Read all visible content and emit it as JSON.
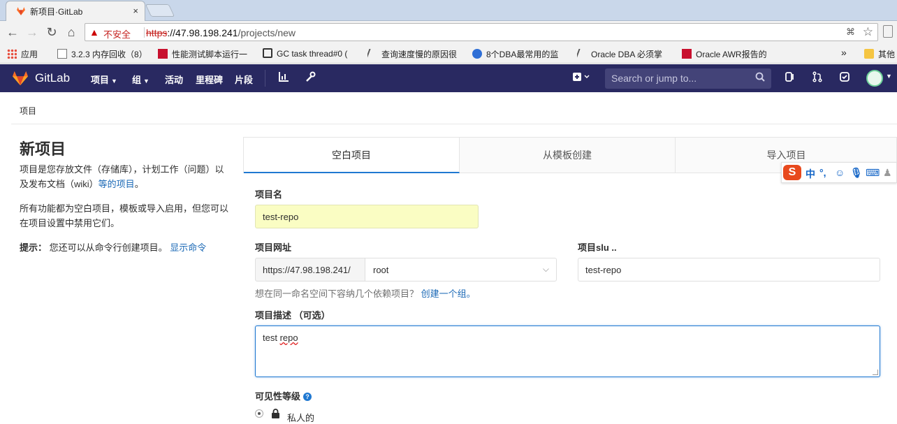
{
  "browser": {
    "tab_title": "新项目·GitLab",
    "tab_close": "×",
    "insecure_label": "不安全",
    "url_scheme": "https",
    "url_host": "://47.98.198.241",
    "url_path": "/projects/new",
    "bookmarks": [
      {
        "label": "应用",
        "icon": "apps-icon",
        "color": "#e74c3c"
      },
      {
        "label": "3.2.3 内存回收（8）",
        "icon": "page-icon",
        "color": "#777777"
      },
      {
        "label": "性能测试脚本运行一",
        "icon": "c-icon",
        "color": "#c8102e"
      },
      {
        "label": "GC task thread#0 (",
        "icon": "g-icon",
        "color": "#333333"
      },
      {
        "label": "查询速度慢的原因很",
        "icon": "sword-icon",
        "color": "#555555"
      },
      {
        "label": "8个DBA最常用的监",
        "icon": "paw-icon",
        "color": "#2f6fd6"
      },
      {
        "label": "Oracle DBA 必须掌",
        "icon": "sword-icon",
        "color": "#555555"
      },
      {
        "label": "Oracle AWR报告的",
        "icon": "c-icon",
        "color": "#c8102e"
      }
    ],
    "bookmarks_more": "»",
    "other_bookmarks": "其他"
  },
  "gitlab": {
    "brand": "GitLab",
    "nav": [
      {
        "label": "项目",
        "caret": true
      },
      {
        "label": "组",
        "caret": true
      },
      {
        "label": "活动",
        "caret": false
      },
      {
        "label": "里程碑",
        "caret": false
      },
      {
        "label": "片段",
        "caret": false
      }
    ],
    "search_placeholder": "Search or jump to...",
    "colors": {
      "header": "#292961",
      "accent": "#1f78d1",
      "logo": "#fc6d26"
    }
  },
  "page": {
    "breadcrumb": "项目",
    "title": "新项目",
    "intro_text": "项目是您存放文件（存储库），计划工作（问题）以及发布文档（wiki）",
    "intro_link": "等的项目",
    "intro_end": "。",
    "features_text": "所有功能都为空白项目，模板或导入启用，但您可以在项目设置中禁用它们。",
    "tip_label": "提示：",
    "tip_text": "您还可以从命令行创建项目。",
    "tip_link": "显示命令",
    "tabs": [
      {
        "label": "空白项目",
        "active": true
      },
      {
        "label": "从模板创建",
        "active": false
      },
      {
        "label": "导入项目",
        "active": false
      }
    ],
    "form": {
      "name_label": "项目名",
      "name_value": "test-repo",
      "url_label": "项目网址",
      "url_prefix": "https://47.98.198.241/",
      "namespace_value": "root",
      "slug_label": "项目slu ..",
      "slug_value": "test-repo",
      "help_text": "想在同一命名空间下容纳几个依赖项目？",
      "help_link": "创建一个组。",
      "desc_label": "项目描述 （可选）",
      "desc_value_word1": "test ",
      "desc_value_word2": "repo",
      "visibility_label": "可见性等级",
      "visibility_private": "私人的"
    }
  },
  "ime_toolbar": {
    "logo": "S",
    "mode": "中"
  }
}
